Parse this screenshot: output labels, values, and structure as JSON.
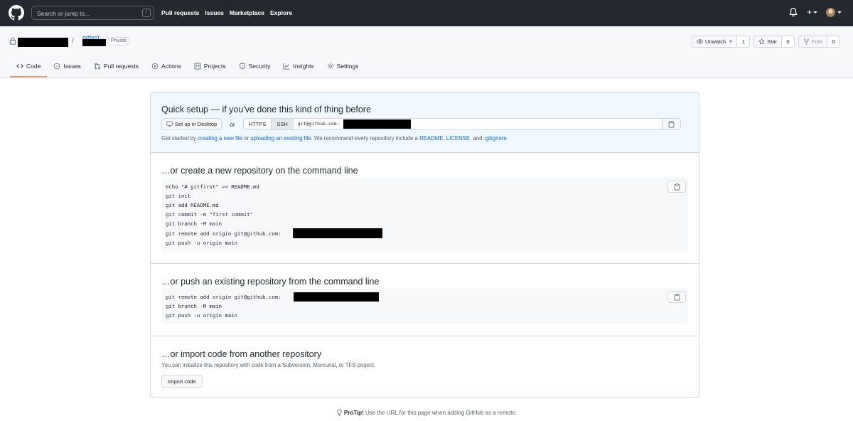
{
  "header": {
    "search_placeholder": "Search or jump to...",
    "search_shortcut": "/",
    "nav": [
      "Pull requests",
      "Issues",
      "Marketplace",
      "Explore"
    ],
    "plus_label": "+"
  },
  "repo": {
    "separator": "/",
    "name_fragment": "gitfirst",
    "visibility": "Private",
    "watch": {
      "label": "Unwatch",
      "count": "1"
    },
    "star": {
      "label": "Star",
      "count": "0"
    },
    "fork": {
      "label": "Fork",
      "count": "0"
    },
    "tabs": [
      {
        "label": "Code",
        "icon": "code-icon",
        "active": true
      },
      {
        "label": "Issues",
        "icon": "issue-icon"
      },
      {
        "label": "Pull requests",
        "icon": "pull-request-icon"
      },
      {
        "label": "Actions",
        "icon": "play-icon"
      },
      {
        "label": "Projects",
        "icon": "project-icon"
      },
      {
        "label": "Security",
        "icon": "shield-icon"
      },
      {
        "label": "Insights",
        "icon": "graph-icon"
      },
      {
        "label": "Settings",
        "icon": "gear-icon"
      }
    ]
  },
  "quick_setup": {
    "title": "Quick setup — if you've done this kind of thing before",
    "desktop_button": "Set up in Desktop",
    "or": "or",
    "https": "HTTPS",
    "ssh": "SSH",
    "selected_protocol": "SSH",
    "url_prefix": "git@github.com:",
    "intro": {
      "t1": "Get started by ",
      "l1": "creating a new file",
      "t2": " or ",
      "l2": "uploading an existing file",
      "t3": ". We recommend every repository include a ",
      "l3": "README",
      "t4": ", ",
      "l4": "LICENSE",
      "t5": ", and ",
      "l5": ".gitignore",
      "t6": "."
    }
  },
  "create_section": {
    "title": "…or create a new repository on the command line",
    "lines": [
      "echo \"# gitfirst\" >> README.md",
      "git init",
      "git add README.md",
      "git commit -m \"first commit\"",
      "git branch -M main",
      "git remote add origin git@github.com:",
      "git push -u origin main"
    ]
  },
  "push_section": {
    "title": "…or push an existing repository from the command line",
    "lines": [
      "git remote add origin git@github.com:",
      "git branch -M main",
      "git push -u origin main"
    ]
  },
  "import_section": {
    "title": "…or import code from another repository",
    "note": "You can initialize this repository with code from a Subversion, Mercurial, or TFS project.",
    "button": "Import code"
  },
  "protip": {
    "bold": "ProTip!",
    "text": " Use the URL for this page when adding GitHub as a remote."
  },
  "colors": {
    "header_bg": "#24292f",
    "link": "#0969da",
    "active_tab_underline": "#fd8c73",
    "quick_setup_bg": "#f1f8ff"
  }
}
